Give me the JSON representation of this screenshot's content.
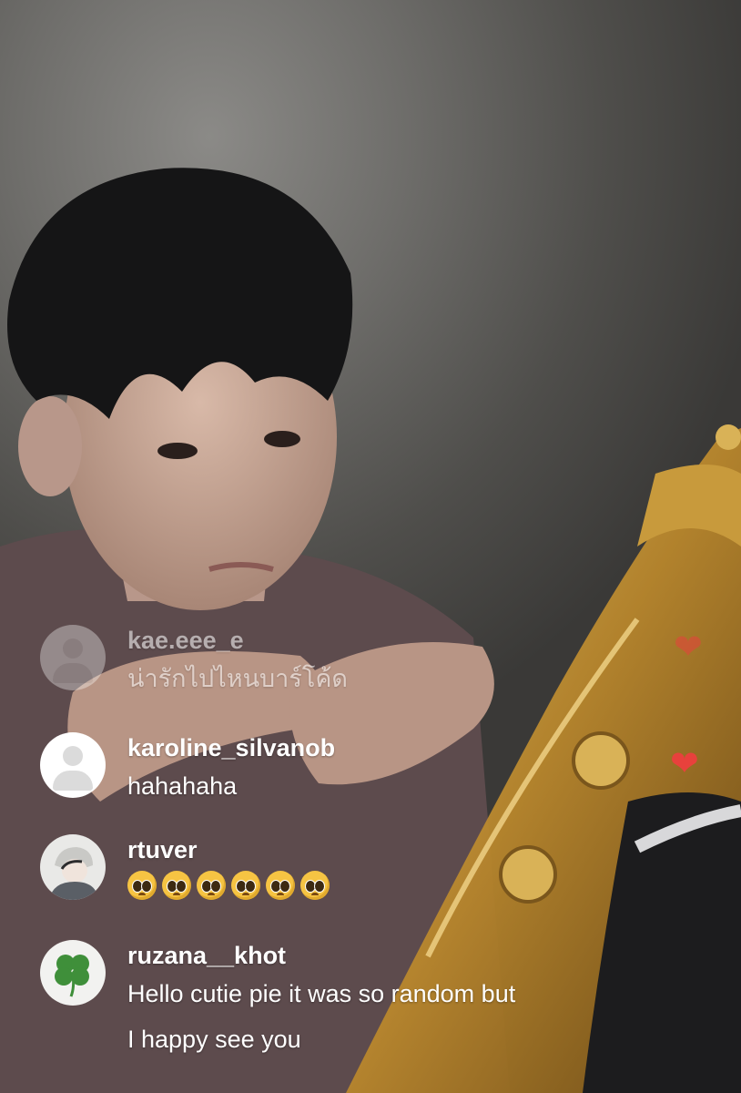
{
  "live": {
    "comments": [
      {
        "username": "kae.eee_e",
        "message": "น่ารักไปไหนบาร์โค้ด",
        "avatar": "default-avatar"
      },
      {
        "username": "karoline_silvanob",
        "message": "hahahaha",
        "avatar": "default-avatar"
      },
      {
        "username": "rtuver",
        "message": "🥺🥺🥺🥺🥺🥺",
        "avatar": "illustrated-avatar"
      },
      {
        "username": "ruzana__khot",
        "message_line1": "Hello cutie pie it was so random but",
        "message_line2": "I happy see you",
        "avatar": "clover-avatar"
      }
    ],
    "reactions": [
      "heart-icon",
      "heart-icon"
    ],
    "colors": {
      "heart": "#e8413c",
      "text": "#ffffff"
    }
  }
}
